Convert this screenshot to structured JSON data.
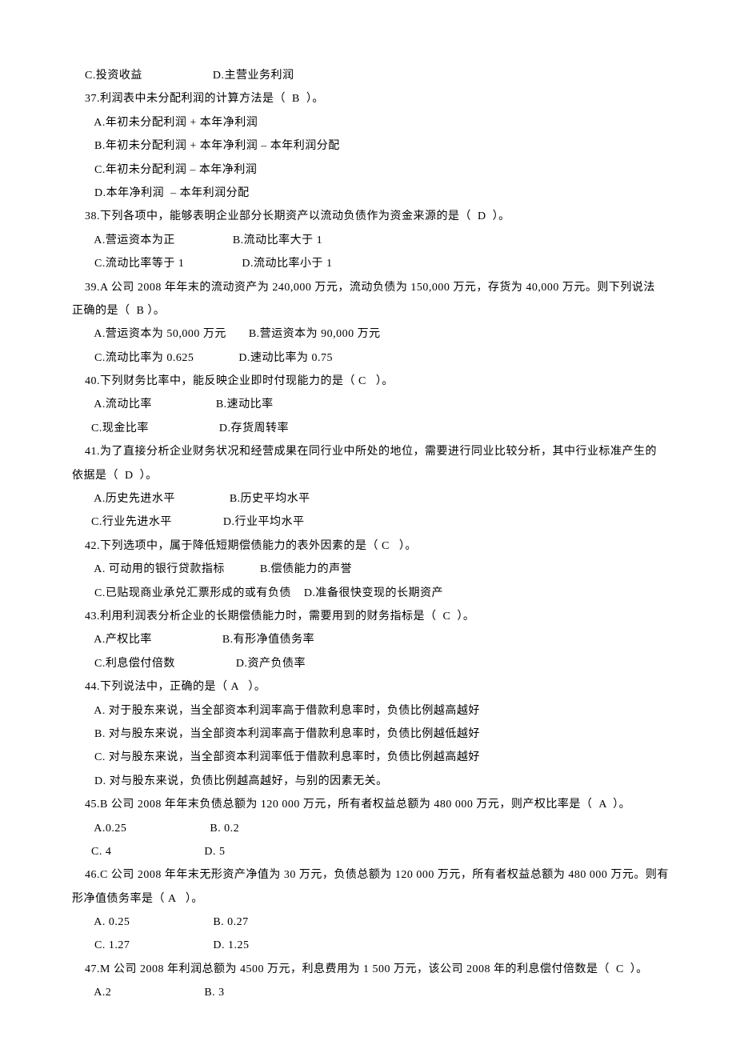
{
  "lines": [
    "    C.投资收益                      D.主营业务利润",
    "    37.利润表中未分配利润的计算方法是（  B  ）。",
    "       A.年初未分配利润 + 本年净利润",
    "       B.年初未分配利润 + 本年净利润 – 本年利润分配",
    "       C.年初未分配利润 – 本年净利润",
    "       D.本年净利润  – 本年利润分配",
    "    38.下列各项中，能够表明企业部分长期资产以流动负债作为资金来源的是（  D  ）。",
    "       A.营运资本为正                  B.流动比率大于 1",
    "       C.流动比率等于 1                  D.流动比率小于 1",
    "    39.A 公司 2008 年年末的流动资产为 240,000 万元，流动负债为 150,000 万元，存货为 40,000 万元。则下列说法",
    "正确的是（  B ）。",
    "       A.营运资本为 50,000 万元       B.营运资本为 90,000 万元",
    "       C.流动比率为 0.625              D.速动比率为 0.75",
    "    40.下列财务比率中，能反映企业即时付现能力的是（ C   ）。",
    "       A.流动比率                    B.速动比率",
    "      C.现金比率                      D.存货周转率",
    "    41.为了直接分析企业财务状况和经营成果在同行业中所处的地位，需要进行同业比较分析，其中行业标准产生的",
    "依据是（  D  ）。",
    "       A.历史先进水平                 B.历史平均水平",
    "      C.行业先进水平                D.行业平均水平",
    "    42.下列选项中，属于降低短期偿债能力的表外因素的是（ C   ）。",
    "       A. 可动用的银行贷款指标           B.偿债能力的声誉",
    "       C.已贴现商业承兑汇票形成的或有负债    D.准备很快变现的长期资产",
    "    43.利用利润表分析企业的长期偿债能力时，需要用到的财务指标是（  C  ）。",
    "       A.产权比率                      B.有形净值债务率",
    "       C.利息偿付倍数                   D.资产负债率",
    "    44.下列说法中，正确的是（ A   ）。",
    "       A. 对于股东来说，当全部资本利润率高于借款利息率时，负债比例越高越好",
    "       B. 对与股东来说，当全部资本利润率高于借款利息率时，负债比例越低越好",
    "       C. 对与股东来说，当全部资本利润率低于借款利息率时，负债比例越高越好",
    "       D. 对与股东来说，负债比例越高越好，与别的因素无关。",
    "    45.B 公司 2008 年年末负债总额为 120 000 万元，所有者权益总额为 480 000 万元，则产权比率是（  A  ）。",
    "       A.0.25                          B. 0.2",
    "      C. 4                             D. 5",
    "    46.C 公司 2008 年年末无形资产净值为 30 万元，负债总额为 120 000 万元，所有者权益总额为 480 000 万元。则有",
    "形净值债务率是（ A   ）。",
    "       A. 0.25                          B. 0.27",
    "       C. 1.27                          D. 1.25",
    "    47.M 公司 2008 年利润总额为 4500 万元，利息费用为 1 500 万元，该公司 2008 年的利息偿付倍数是（  C  ）。",
    "       A.2                             B. 3"
  ]
}
